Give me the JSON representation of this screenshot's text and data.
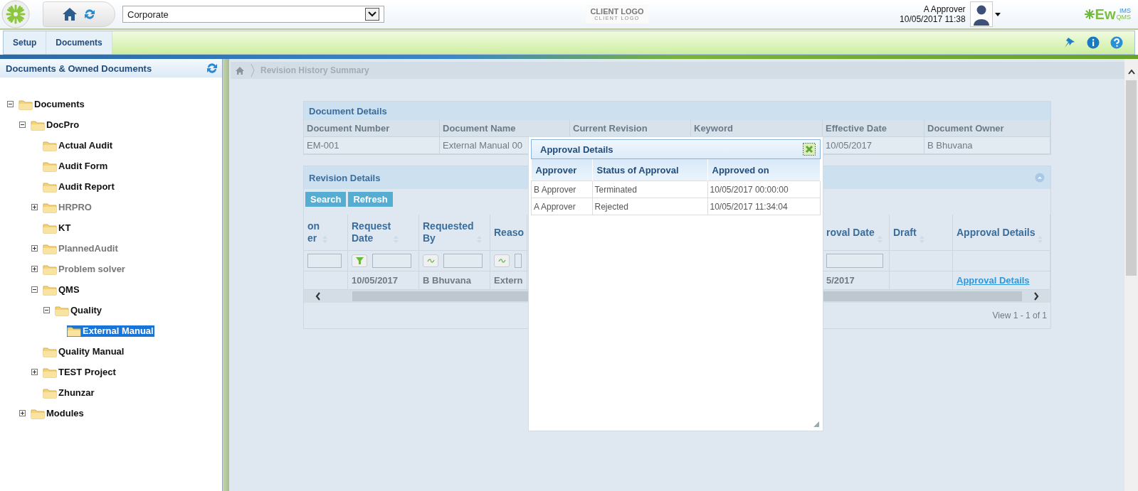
{
  "header": {
    "location_select": {
      "value": "Corporate"
    },
    "client_logo": {
      "title": "CLIENT LOGO",
      "subtitle": "CLIENT LOGO"
    },
    "user": {
      "name": "A Approver",
      "datetime": "10/05/2017 11:38"
    },
    "brand": {
      "main": "Ew",
      "top": "IMS",
      "bottom": "QMS"
    }
  },
  "menu": {
    "tabs": [
      {
        "label": "Setup",
        "selected": false
      },
      {
        "label": "Documents",
        "selected": false
      }
    ]
  },
  "sidebar": {
    "title": "Documents & Owned Documents",
    "tree": [
      {
        "label": "Documents",
        "expanded": true,
        "selected": false,
        "disabled": false,
        "children": [
          {
            "label": "DocPro",
            "expanded": true,
            "selected": false,
            "disabled": false,
            "children": [
              {
                "label": "Actual Audit",
                "selected": false,
                "disabled": false
              },
              {
                "label": "Audit Form",
                "selected": false,
                "disabled": false
              },
              {
                "label": "Audit Report",
                "selected": false,
                "disabled": false
              },
              {
                "label": "HRPRO",
                "expanded": false,
                "selected": false,
                "disabled": true
              },
              {
                "label": "KT",
                "selected": false,
                "disabled": false
              },
              {
                "label": "PlannedAudit",
                "expanded": false,
                "selected": false,
                "disabled": true
              },
              {
                "label": "Problem solver",
                "expanded": false,
                "selected": false,
                "disabled": true
              },
              {
                "label": "QMS",
                "expanded": true,
                "selected": false,
                "disabled": false,
                "children": [
                  {
                    "label": "Quality",
                    "expanded": true,
                    "selected": false,
                    "disabled": false,
                    "children": [
                      {
                        "label": "External Manual",
                        "selected": true,
                        "disabled": false
                      }
                    ]
                  }
                ]
              },
              {
                "label": "Quality Manual",
                "selected": false,
                "disabled": false
              },
              {
                "label": "TEST Project",
                "expanded": false,
                "selected": false,
                "disabled": false
              },
              {
                "label": "Zhunzar",
                "selected": false,
                "disabled": false
              }
            ]
          },
          {
            "label": "Modules",
            "expanded": false,
            "selected": false,
            "disabled": false
          }
        ]
      }
    ]
  },
  "breadcrumb": [
    "Revision History Summary"
  ],
  "document_details": {
    "title": "Document Details",
    "fields": [
      {
        "label": "Document Number",
        "value": "EM-001"
      },
      {
        "label": "Document Name",
        "value": "External Manual 00"
      },
      {
        "label": "Current Revision"
      },
      {
        "label": "Keyword"
      },
      {
        "label": "Effective Date",
        "value": "10/05/2017"
      },
      {
        "label": "Document Owner",
        "value": "B Bhuvana"
      }
    ]
  },
  "revision_details": {
    "title": "Revision Details",
    "buttons": [
      "Search",
      "Refresh"
    ],
    "left_columns": [
      {
        "label": "on\ner",
        "filter": {
          "kind": "input"
        },
        "sortable": true
      },
      {
        "label": "Request\nDate",
        "filter": {
          "kind": "funnel"
        },
        "sortable": true,
        "cell": "10/05/2017"
      },
      {
        "label": "Requested\nBy",
        "filter": {
          "kind": "contains"
        },
        "sortable": true,
        "cell": "B Bhuvana"
      },
      {
        "label": "Reaso",
        "filter": {
          "kind": "contains"
        },
        "sortable": false,
        "cell": "Extern"
      }
    ],
    "right_columns": [
      {
        "label": "roval Date",
        "filter": {
          "kind": "input"
        },
        "sortable": true,
        "cell": "5/2017"
      },
      {
        "label": "Draft",
        "sortable": true
      },
      {
        "label": "Approval Details",
        "sortable": true,
        "link": "Approval Details"
      }
    ],
    "pager": "View 1 - 1 of 1"
  },
  "dialog": {
    "title": "Approval Details",
    "columns": [
      "Approver",
      "Status of Approval",
      "Approved on"
    ],
    "rows": [
      [
        "B Approver",
        "Terminated",
        "10/05/2017 00:00:00"
      ],
      [
        "A Approver",
        "Rejected",
        "10/05/2017 11:34:04"
      ]
    ]
  }
}
